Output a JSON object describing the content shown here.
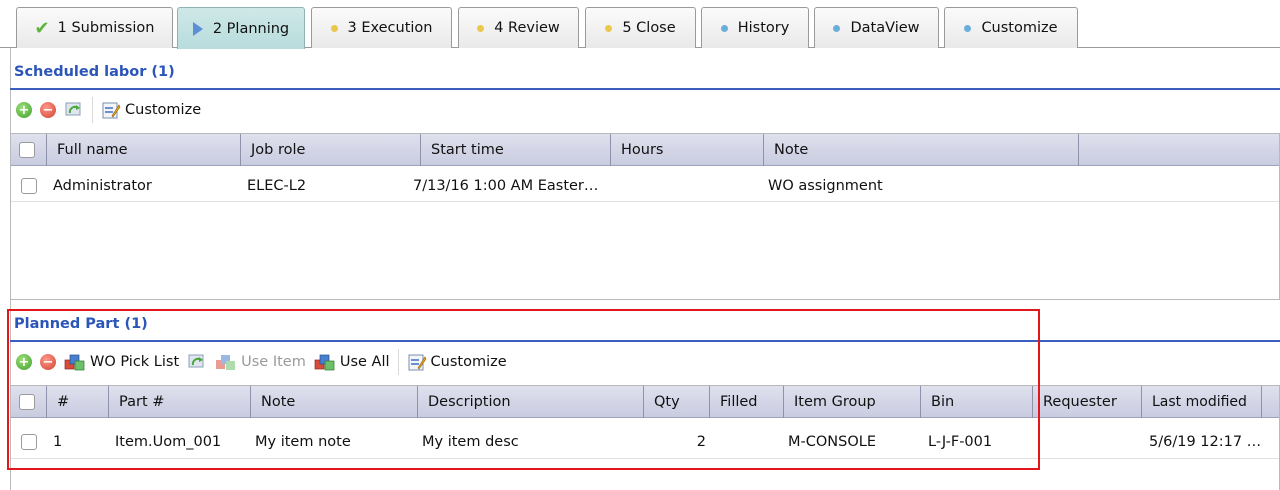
{
  "tabs": [
    {
      "label": "1 Submission",
      "icon": "check-icon"
    },
    {
      "label": "2 Planning",
      "icon": "play-arrow-icon",
      "active": true
    },
    {
      "label": "3 Execution",
      "icon": "yellow-dot-icon"
    },
    {
      "label": "4 Review",
      "icon": "yellow-dot-icon"
    },
    {
      "label": "5 Close",
      "icon": "yellow-dot-icon"
    },
    {
      "label": "History",
      "icon": "blue-dot-icon"
    },
    {
      "label": "DataView",
      "icon": "blue-dot-icon"
    },
    {
      "label": "Customize",
      "icon": "blue-dot-icon"
    }
  ],
  "labor": {
    "title": "Scheduled labor (1)",
    "toolbar": {
      "customize_label": "Customize"
    },
    "columns": [
      "Full name",
      "Job role",
      "Start time",
      "Hours",
      "Note"
    ],
    "rows": [
      {
        "full_name": "Administrator",
        "job_role": "ELEC-L2",
        "start_time": "7/13/16 1:00 AM Easter…",
        "hours": "",
        "note": "WO assignment"
      }
    ]
  },
  "parts": {
    "title": "Planned Part (1)",
    "toolbar": {
      "wo_pick_list_label": "WO Pick List",
      "use_item_label": "Use Item",
      "use_all_label": "Use All",
      "customize_label": "Customize"
    },
    "columns": [
      "#",
      "Part #",
      "Note",
      "Description",
      "Qty",
      "Filled",
      "Item Group",
      "Bin",
      "Requester",
      "Last modified"
    ],
    "rows": [
      {
        "num": "1",
        "part": "Item.Uom_001",
        "note": "My item note",
        "description": "My item desc",
        "qty": "2",
        "filled": "",
        "item_group": "M-CONSOLE",
        "bin": "L-J-F-001",
        "requester": "",
        "last_modified": "5/6/19 12:17 …"
      }
    ]
  },
  "colors": {
    "accent": "#2b55b8",
    "highlight": "#e3171b",
    "header_bg": "#c9cbe0"
  }
}
